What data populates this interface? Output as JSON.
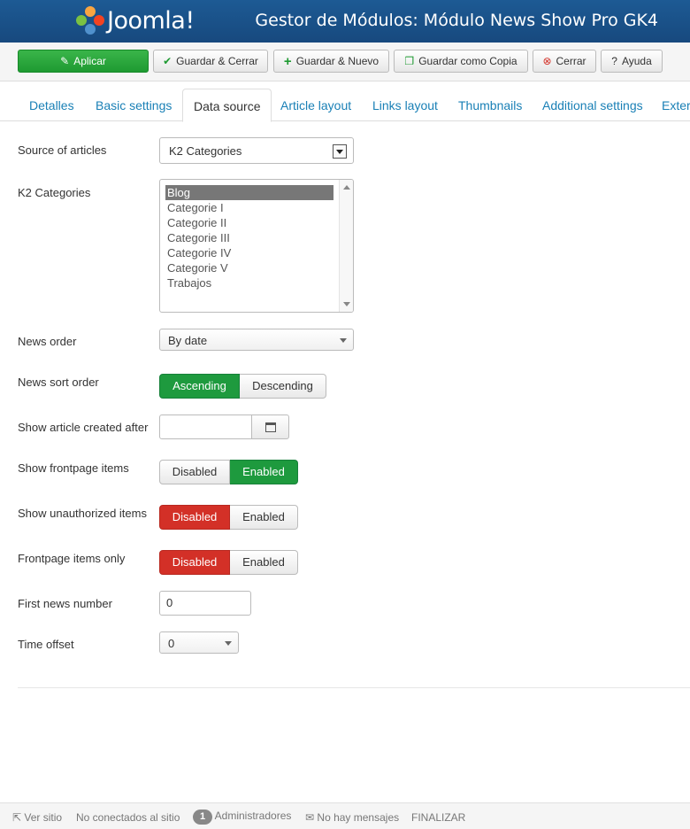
{
  "header": {
    "logo_text": "Joomla!",
    "title": "Gestor de Módulos: Módulo News Show Pro GK4"
  },
  "toolbar": {
    "apply": "Aplicar",
    "save_close": "Guardar & Cerrar",
    "save_new": "Guardar & Nuevo",
    "save_copy": "Guardar como Copia",
    "close": "Cerrar",
    "help": "Ayuda"
  },
  "tabs": [
    "Detalles",
    "Basic settings",
    "Data source",
    "Article layout",
    "Links layout",
    "Thumbnails",
    "Additional settings",
    "Exter"
  ],
  "form": {
    "source_label": "Source of articles",
    "source_value": "K2 Categories",
    "k2_label": "K2 Categories",
    "k2_options": [
      "Blog",
      "Categorie I",
      "Categorie II",
      "Categorie III",
      "Categorie IV",
      "Categorie V",
      "Trabajos"
    ],
    "order_label": "News order",
    "order_value": "By date",
    "sort_label": "News sort order",
    "sort_asc": "Ascending",
    "sort_desc": "Descending",
    "created_after_label": "Show article created after",
    "created_after_value": "",
    "frontpage_label": "Show frontpage items",
    "unauth_label": "Show unauthorized items",
    "frontonly_label": "Frontpage items only",
    "disabled": "Disabled",
    "enabled": "Enabled",
    "first_news_label": "First news number",
    "first_news_value": "0",
    "time_offset_label": "Time offset",
    "time_offset_value": "0"
  },
  "status": {
    "view_site": "Ver sitio",
    "not_connected": "No conectados al sitio",
    "admins_count": "1",
    "admins": "Administradores",
    "messages": "No hay mensajes",
    "logout": "FINALIZAR"
  },
  "colors": {
    "header": "#17497e",
    "primary": "#1e9a32",
    "danger": "#d33027",
    "link": "#1a80b6"
  }
}
